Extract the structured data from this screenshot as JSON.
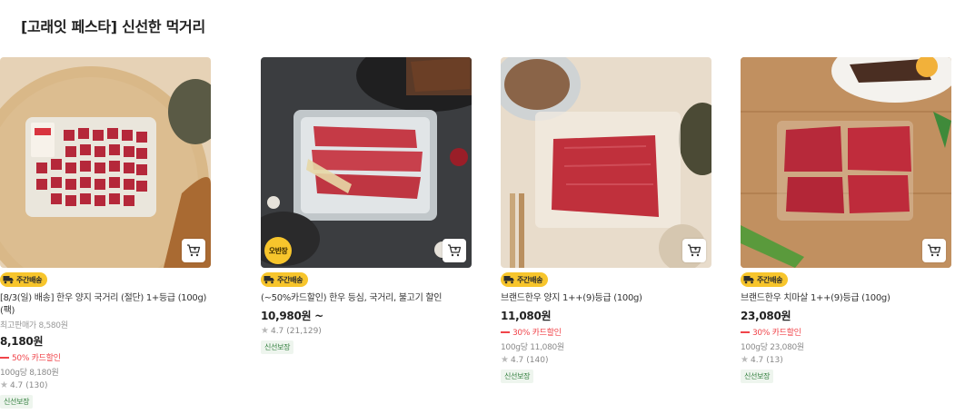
{
  "section": {
    "title": "[고래잇 페스타] 신선한 먹거리"
  },
  "colors": {
    "badge": "#f7c52c",
    "discount": "#f0444a",
    "guarantee_text": "#2f7d3b"
  },
  "products": [
    {
      "corner_badge": "오반장",
      "delivery": "주간배송",
      "name": "(~50%카드할인) 한우 등심, 국거리, 불고기 할인",
      "price": "10,980원 ~",
      "rating": "4.7",
      "reviews": "(21,129)",
      "guarantee": "신선보장",
      "cart_icon": "cart-icon"
    },
    {
      "delivery": "주간배송",
      "name": "브랜드한우 양지 1++(9)등급 (100g)",
      "price": "11,080원",
      "discount": "30% 카드할인",
      "unit_price": "100g당 11,080원",
      "rating": "4.7",
      "reviews": "(140)",
      "guarantee": "신선보장",
      "cart_icon": "cart-icon"
    },
    {
      "delivery": "주간배송",
      "name": "브랜드한우 치마살 1++(9)등급 (100g)",
      "price": "23,080원",
      "discount": "30% 카드할인",
      "unit_price": "100g당 23,080원",
      "rating": "4.7",
      "reviews": "(13)",
      "guarantee": "신선보장",
      "cart_icon": "cart-icon"
    },
    {
      "delivery": "주간배송",
      "name": "[8/3(일) 배송] 한우 양지 국거리 (절단) 1+등급 (100g) (팩)",
      "original_price": "최고판매가 8,580원",
      "price": "8,180원",
      "discount": "50% 카드할인",
      "unit_price": "100g당 8,180원",
      "rating": "4.7",
      "reviews": "(130)",
      "guarantee": "신선보장",
      "cart_icon": "cart-icon"
    }
  ]
}
